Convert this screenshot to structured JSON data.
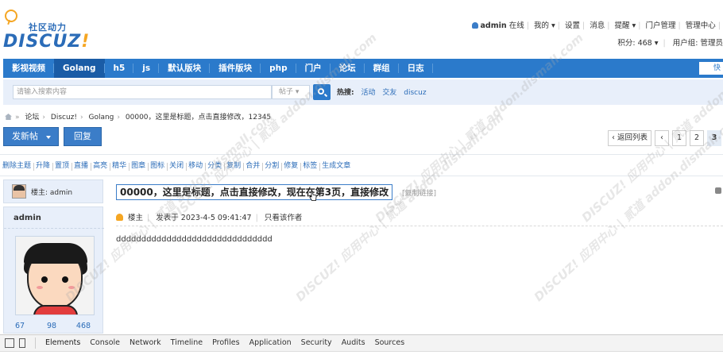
{
  "header": {
    "logo_sub": "社区动力",
    "logo_main": "DISCUZ",
    "logo_bang": "!",
    "user": {
      "name": "admin",
      "online": "在线",
      "links": [
        "我的",
        "设置",
        "消息",
        "提醒",
        "门户管理",
        "管理中心"
      ],
      "credits": "积分: 468",
      "group": "用户组: 管理员"
    }
  },
  "nav": {
    "items": [
      "影视视频",
      "Golang",
      "h5",
      "js",
      "默认版块",
      "插件版块",
      "php",
      "门户",
      "论坛",
      "群组",
      "日志"
    ],
    "active": "Golang",
    "quick": "快"
  },
  "search": {
    "placeholder": "请输入搜索内容",
    "type": "帖子",
    "hot_label": "热搜:",
    "hot_words": [
      "活动",
      "交友",
      "discuz"
    ]
  },
  "breadcrumb": [
    "论坛",
    "Discuz!",
    "Golang",
    "00000，这里是标题，点击直接修改，12345"
  ],
  "actions": {
    "post": "发新帖",
    "reply": "回复"
  },
  "pager": {
    "back": "返回列表",
    "pages": [
      "1",
      "2",
      "3"
    ],
    "current": "3"
  },
  "mod_actions": [
    "删除主题",
    "升降",
    "置顶",
    "直播",
    "高亮",
    "精华",
    "图章",
    "图标",
    "关闭",
    "移动",
    "分类",
    "复制",
    "合并",
    "分割",
    "修复",
    "标签",
    "生成文章"
  ],
  "thread": {
    "louzhu": "楼主: admin",
    "title": "00000，这里是标题，点击直接修改，现在在第3页，直接修改",
    "copy_link": "[复制链接]"
  },
  "post": {
    "author": "admin",
    "floor": "楼主",
    "posted": "发表于 2023-4-5 09:41:47",
    "only_author": "只看该作者",
    "content": "ddddddddddddddddddddddddddddddd",
    "stats": [
      "67",
      "98",
      "468"
    ]
  },
  "devtools": {
    "tabs": [
      "Elements",
      "Console",
      "Network",
      "Timeline",
      "Profiles",
      "Application",
      "Security",
      "Audits",
      "Sources"
    ],
    "active": "Elements"
  },
  "watermark": "DISCUZ! 应用中心 | 贰道 addon.dismall.com",
  "colors": {
    "nav": "#2b7acb",
    "nav_active": "#1a5ca6",
    "link": "#2b6cb8",
    "panel": "#e8effa"
  }
}
